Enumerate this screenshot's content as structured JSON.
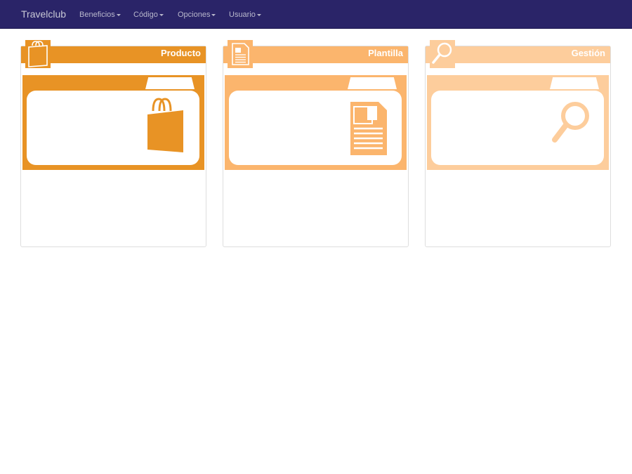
{
  "navbar": {
    "brand": "Travelclub",
    "items": [
      {
        "label": "Beneficios"
      },
      {
        "label": "Código"
      },
      {
        "label": "Opciones"
      },
      {
        "label": "Usuario"
      }
    ]
  },
  "panels": [
    {
      "title": "Producto",
      "icon": "shopping-bag-icon",
      "color": "#e89325"
    },
    {
      "title": "Plantilla",
      "icon": "document-icon",
      "color": "#fbb56d"
    },
    {
      "title": "Gestión",
      "icon": "magnifier-icon",
      "color": "#fdcd9c"
    }
  ]
}
